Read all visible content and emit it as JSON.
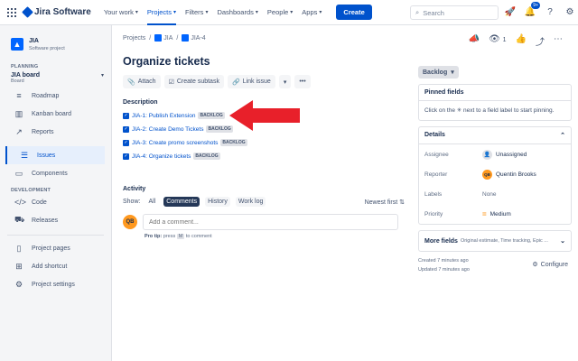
{
  "topbar": {
    "logo": "Jira Software",
    "nav": [
      {
        "label": "Your work",
        "active": false
      },
      {
        "label": "Projects",
        "active": true
      },
      {
        "label": "Filters",
        "active": false
      },
      {
        "label": "Dashboards",
        "active": false
      },
      {
        "label": "People",
        "active": false
      },
      {
        "label": "Apps",
        "active": false
      }
    ],
    "create_label": "Create",
    "search_placeholder": "Search",
    "notification_badge": "9+",
    "avatar_initials": "QB"
  },
  "sidebar": {
    "project_name": "JIA",
    "project_type": "Software project",
    "planning_heading": "PLANNING",
    "board_name": "JIA board",
    "board_type": "Board",
    "planning_items": [
      {
        "label": "Roadmap",
        "icon": "roadmap-icon"
      },
      {
        "label": "Kanban board",
        "icon": "kanban-icon"
      },
      {
        "label": "Reports",
        "icon": "reports-icon"
      }
    ],
    "active_item": "Issues",
    "components_item": "Components",
    "development_heading": "DEVELOPMENT",
    "dev_items": [
      {
        "label": "Code",
        "icon": "code-icon"
      },
      {
        "label": "Releases",
        "icon": "releases-icon"
      }
    ],
    "bottom_items": [
      {
        "label": "Project pages",
        "icon": "pages-icon"
      },
      {
        "label": "Add shortcut",
        "icon": "shortcut-icon"
      },
      {
        "label": "Project settings",
        "icon": "settings-icon"
      }
    ]
  },
  "issue": {
    "breadcrumbs": [
      "Projects",
      "JIA",
      "JIA-4"
    ],
    "title": "Organize tickets",
    "actions": [
      "Attach",
      "Create subtask",
      "Link issue"
    ],
    "description_label": "Description",
    "subtasks": [
      {
        "text": "JIA-1: Publish Extension",
        "status": "BACKLOG"
      },
      {
        "text": "JIA-2: Create Demo Tickets",
        "status": "BACKLOG"
      },
      {
        "text": "JIA-3: Create promo screenshots",
        "status": "BACKLOG"
      },
      {
        "text": "JIA-4: Organize tickets",
        "status": "BACKLOG"
      }
    ],
    "activity_label": "Activity",
    "show_label": "Show:",
    "filters": [
      "All",
      "Comments",
      "History",
      "Work log"
    ],
    "active_filter": "Comments",
    "sort_label": "Newest first",
    "comment_placeholder": "Add a comment...",
    "tip_prefix": "Pro tip:",
    "tip_press": "press",
    "tip_key": "M",
    "tip_suffix": "to comment",
    "commenter_initials": "QB",
    "arrow_color": "#e8202a"
  },
  "details": {
    "watch_count": "1",
    "status": "Backlog",
    "pinned_title": "Pinned fields",
    "pinned_body": "Click on the ✳ next to a field label to start pinning.",
    "details_title": "Details",
    "fields": [
      {
        "label": "Assignee",
        "value": "Unassigned"
      },
      {
        "label": "Reporter",
        "value": "Quentin Brooks"
      },
      {
        "label": "Labels",
        "value": "None"
      },
      {
        "label": "Priority",
        "value": "Medium"
      }
    ],
    "reporter_initials": "QB",
    "more_fields": "More fields",
    "more_fields_sub": "Original estimate, Time tracking, Epic ...",
    "created": "Created 7 minutes ago",
    "updated": "Updated 7 minutes ago",
    "configure": "Configure"
  }
}
